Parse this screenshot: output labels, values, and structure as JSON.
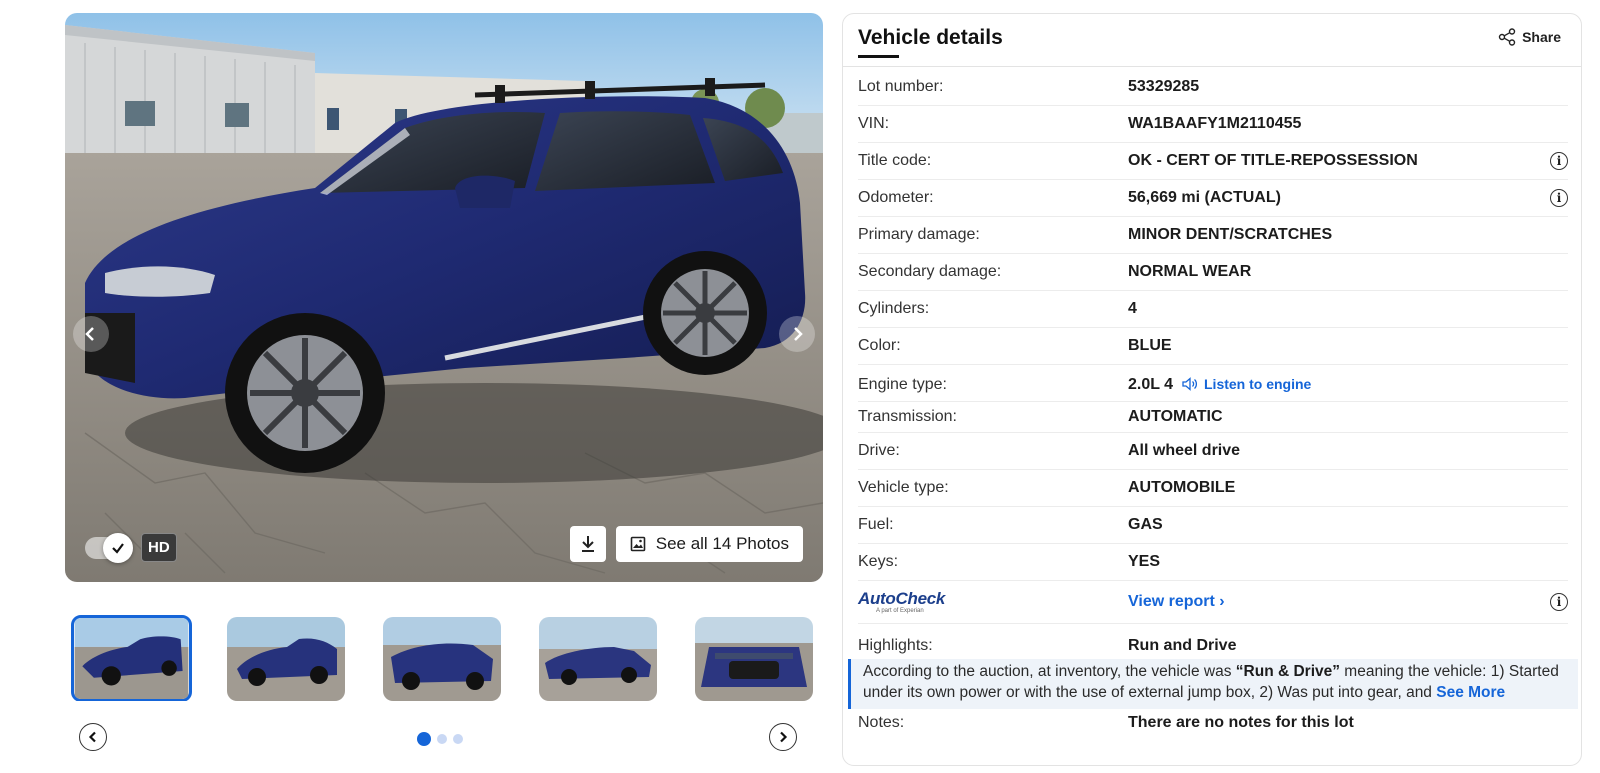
{
  "gallery": {
    "see_all_label": "See all 14 Photos",
    "hd_label": "HD",
    "hd_enabled": true,
    "current_dot": 0,
    "dot_count": 3,
    "thumbnail_count": 5,
    "selected_thumbnail": 0
  },
  "details": {
    "title": "Vehicle details",
    "share_label": "Share",
    "rows": {
      "lot": {
        "label": "Lot number:",
        "value": "53329285"
      },
      "vin": {
        "label": "VIN:",
        "value": "WA1BAAFY1M2110455"
      },
      "title_code": {
        "label": "Title code:",
        "value": "OK - CERT OF TITLE-REPOSSESSION"
      },
      "odometer": {
        "label": "Odometer:",
        "value": "56,669 mi (ACTUAL)"
      },
      "primary": {
        "label": "Primary damage:",
        "value": "MINOR DENT/SCRATCHES"
      },
      "secondary": {
        "label": "Secondary damage:",
        "value": "NORMAL WEAR"
      },
      "cylinders": {
        "label": "Cylinders:",
        "value": "4"
      },
      "color": {
        "label": "Color:",
        "value": "BLUE"
      },
      "engine": {
        "label": "Engine type:",
        "value": "2.0L 4",
        "listen_label": "Listen to engine"
      },
      "transmission": {
        "label": "Transmission:",
        "value": "AUTOMATIC"
      },
      "drive": {
        "label": "Drive:",
        "value": "All wheel drive"
      },
      "vehicle_type": {
        "label": "Vehicle type:",
        "value": "AUTOMOBILE"
      },
      "fuel": {
        "label": "Fuel:",
        "value": "GAS"
      },
      "keys": {
        "label": "Keys:",
        "value": "YES"
      },
      "autocheck": {
        "brand": "AutoCheck",
        "tagline": "A part of Experian",
        "link_label": "View report"
      },
      "highlights": {
        "label": "Highlights:",
        "value": "Run and Drive"
      },
      "notes": {
        "label": "Notes:",
        "value": "There are no notes for this lot"
      }
    },
    "highlight_text": {
      "before": "According to the auction, at inventory, the vehicle was ",
      "emphasis": "“Run & Drive”",
      "after": " meaning the vehicle: 1) Started under its own power or with the use of external jump box, 2) Was put into gear, and ",
      "see_more": "See More"
    }
  }
}
